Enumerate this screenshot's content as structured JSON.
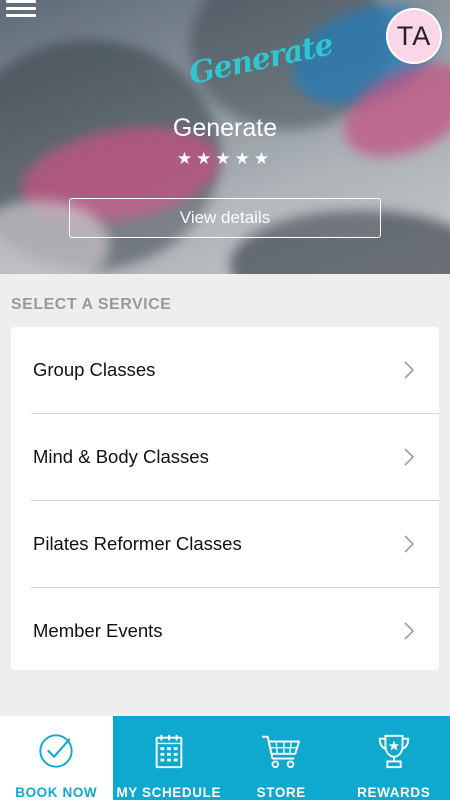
{
  "header": {
    "logo_text": "Generate",
    "avatar_initials": "TA",
    "gym_name": "Generate",
    "rating_stars": "★★★★★",
    "rating": 5,
    "view_details_label": "View details"
  },
  "services": {
    "heading": "SELECT A SERVICE",
    "items": [
      {
        "label": "Group Classes"
      },
      {
        "label": "Mind & Body Classes"
      },
      {
        "label": "Pilates Reformer Classes"
      },
      {
        "label": "Member Events"
      }
    ]
  },
  "bottom_nav": {
    "items": [
      {
        "label": "BOOK NOW",
        "icon": "checkmark-circle-icon",
        "active": true
      },
      {
        "label": "MY SCHEDULE",
        "icon": "calendar-icon",
        "active": false
      },
      {
        "label": "STORE",
        "icon": "shopping-cart-icon",
        "active": false
      },
      {
        "label": "REWARDS",
        "icon": "trophy-icon",
        "active": false
      }
    ]
  },
  "colors": {
    "accent": "#0fa8cf",
    "avatar_bg": "#f9d7e8",
    "background": "#eeeeee",
    "heading_gray": "#9a9a9a"
  }
}
